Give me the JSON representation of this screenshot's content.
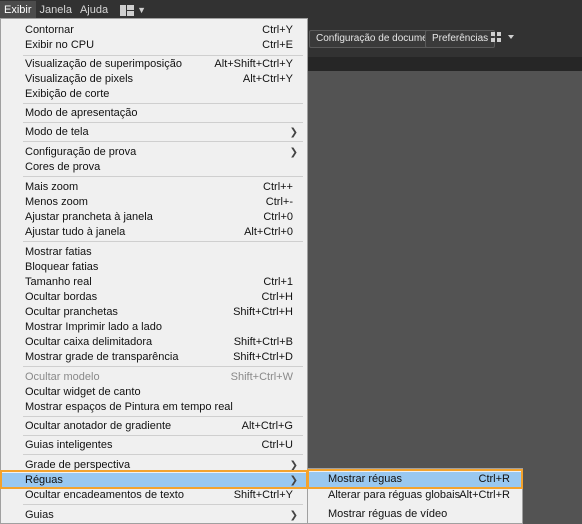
{
  "menubar": {
    "items": [
      "Exibir",
      "Janela",
      "Ajuda"
    ],
    "workspace_icon": "workspace-grid-icon"
  },
  "controlbar": {
    "doc_setup": "Configuração de documento",
    "preferences": "Preferências",
    "arrange_icon": "arrange-documents-icon"
  },
  "menu": {
    "items": [
      {
        "label": "Contornar",
        "shortcut": "Ctrl+Y"
      },
      {
        "label": "Exibir no CPU",
        "shortcut": "Ctrl+E"
      },
      {
        "label": "Visualização de superimposição",
        "shortcut": "Alt+Shift+Ctrl+Y"
      },
      {
        "label": "Visualização de pixels",
        "shortcut": "Alt+Ctrl+Y"
      },
      {
        "label": "Exibição de corte",
        "shortcut": ""
      },
      {
        "label": "Modo de apresentação",
        "shortcut": ""
      },
      {
        "label": "Modo de tela",
        "shortcut": ""
      },
      {
        "label": "Configuração de prova",
        "shortcut": ""
      },
      {
        "label": "Cores de prova",
        "shortcut": ""
      },
      {
        "label": "Mais zoom",
        "shortcut": "Ctrl++"
      },
      {
        "label": "Menos zoom",
        "shortcut": "Ctrl+-"
      },
      {
        "label": "Ajustar prancheta à janela",
        "shortcut": "Ctrl+0"
      },
      {
        "label": "Ajustar tudo à janela",
        "shortcut": "Alt+Ctrl+0"
      },
      {
        "label": "Mostrar fatias",
        "shortcut": ""
      },
      {
        "label": "Bloquear fatias",
        "shortcut": ""
      },
      {
        "label": "Tamanho real",
        "shortcut": "Ctrl+1"
      },
      {
        "label": "Ocultar bordas",
        "shortcut": "Ctrl+H"
      },
      {
        "label": "Ocultar pranchetas",
        "shortcut": "Shift+Ctrl+H"
      },
      {
        "label": "Mostrar Imprimir lado a lado",
        "shortcut": ""
      },
      {
        "label": "Ocultar caixa delimitadora",
        "shortcut": "Shift+Ctrl+B"
      },
      {
        "label": "Mostrar grade de transparência",
        "shortcut": "Shift+Ctrl+D"
      },
      {
        "label": "Ocultar modelo",
        "shortcut": "Shift+Ctrl+W"
      },
      {
        "label": "Ocultar widget de canto",
        "shortcut": ""
      },
      {
        "label": "Mostrar espaços de Pintura em tempo real",
        "shortcut": ""
      },
      {
        "label": "Ocultar anotador de gradiente",
        "shortcut": "Alt+Ctrl+G"
      },
      {
        "label": "Guias inteligentes",
        "shortcut": "Ctrl+U"
      },
      {
        "label": "Grade de perspectiva",
        "shortcut": ""
      },
      {
        "label": "Réguas",
        "shortcut": ""
      },
      {
        "label": "Ocultar encadeamentos de texto",
        "shortcut": "Shift+Ctrl+Y"
      },
      {
        "label": "Guias",
        "shortcut": ""
      }
    ]
  },
  "submenu": {
    "items": [
      {
        "label": "Mostrar réguas",
        "shortcut": "Ctrl+R"
      },
      {
        "label": "Alterar para réguas globais",
        "shortcut": "Alt+Ctrl+R"
      },
      {
        "label": "Mostrar réguas de vídeo",
        "shortcut": ""
      }
    ]
  },
  "colors": {
    "highlight": "#99c8f0",
    "callout": "#f4a32d"
  }
}
